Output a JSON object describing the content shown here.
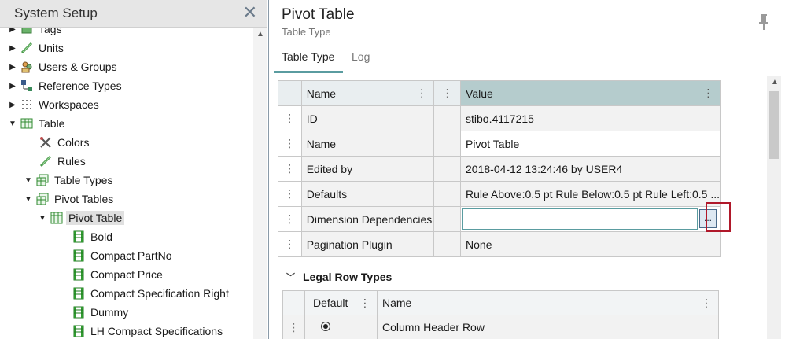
{
  "left_panel": {
    "title": "System Setup",
    "tree": [
      {
        "label": "Tags",
        "level": 0,
        "expand": "collapsed",
        "icon": "tags-icon"
      },
      {
        "label": "Units",
        "level": 0,
        "expand": "collapsed",
        "icon": "ruler-icon"
      },
      {
        "label": "Users & Groups",
        "level": 0,
        "expand": "collapsed",
        "icon": "users-icon"
      },
      {
        "label": "Reference Types",
        "level": 0,
        "expand": "collapsed",
        "icon": "reference-types-icon"
      },
      {
        "label": "Workspaces",
        "level": 0,
        "expand": "collapsed",
        "icon": "workspaces-icon"
      },
      {
        "label": "Table",
        "level": 0,
        "expand": "expanded",
        "icon": "table-icon"
      },
      {
        "label": "Colors",
        "level": 1,
        "expand": "none",
        "icon": "colors-icon"
      },
      {
        "label": "Rules",
        "level": 1,
        "expand": "none",
        "icon": "ruler-icon"
      },
      {
        "label": "Table Types",
        "level": 1,
        "expand": "expanded",
        "icon": "table-types-icon"
      },
      {
        "label": "Pivot Tables",
        "level": 2,
        "expand": "expanded",
        "icon": "pivot-tables-icon"
      },
      {
        "label": "Pivot Table",
        "level": 3,
        "expand": "expanded",
        "icon": "pivot-table-icon",
        "selected": true
      },
      {
        "label": "Bold",
        "level": 4,
        "expand": "none",
        "icon": "table-item-icon"
      },
      {
        "label": "Compact PartNo",
        "level": 4,
        "expand": "none",
        "icon": "table-item-icon"
      },
      {
        "label": "Compact Price",
        "level": 4,
        "expand": "none",
        "icon": "table-item-icon"
      },
      {
        "label": "Compact Specification Right",
        "level": 4,
        "expand": "none",
        "icon": "table-item-icon"
      },
      {
        "label": "Dummy",
        "level": 4,
        "expand": "none",
        "icon": "table-item-icon"
      },
      {
        "label": "LH Compact Specifications",
        "level": 4,
        "expand": "none",
        "icon": "table-item-icon"
      }
    ]
  },
  "header": {
    "title": "Pivot Table",
    "subtitle": "Table Type"
  },
  "tabs": [
    {
      "label": "Table Type",
      "active": true
    },
    {
      "label": "Log",
      "active": false
    }
  ],
  "properties": {
    "col_name": "Name",
    "col_value": "Value",
    "rows": [
      {
        "name": "ID",
        "value": "stibo.4117215",
        "editable": false
      },
      {
        "name": "Name",
        "value": "Pivot Table",
        "editable": true
      },
      {
        "name": "Edited by",
        "value": "2018-04-12 13:24:46 by USER4",
        "editable": false
      },
      {
        "name": "Defaults",
        "value": "Rule Above:0.5 pt Rule Below:0.5 pt Rule Left:0.5 ...",
        "editable": false
      },
      {
        "name": "Dimension Dependencies",
        "value": "",
        "editable": true,
        "browse_label": "..."
      },
      {
        "name": "Pagination Plugin",
        "value": "None",
        "editable": false
      }
    ]
  },
  "legal_row_types": {
    "title": "Legal Row Types",
    "col_default": "Default",
    "col_name": "Name",
    "rows": [
      {
        "default_selected": true,
        "name": "Column Header Row"
      }
    ]
  }
}
